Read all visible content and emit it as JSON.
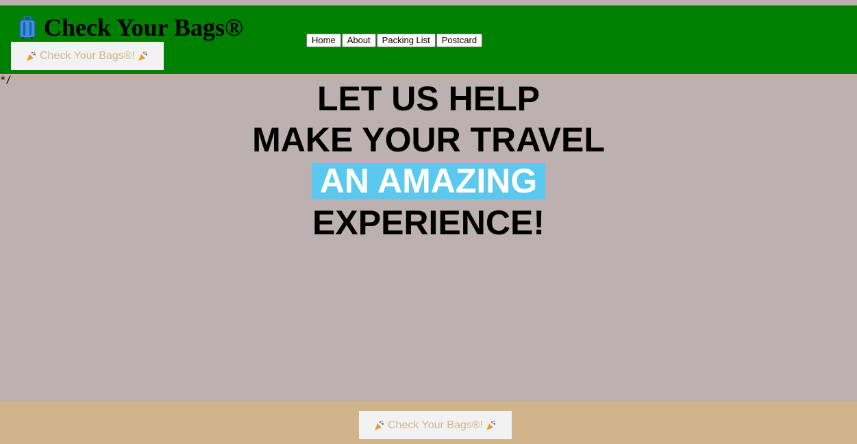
{
  "header": {
    "title": "Check Your Bags®",
    "title_icon": "luggage-icon",
    "celebrate_button": {
      "label": "Check Your Bags®!",
      "icon": "party-popper-icon"
    }
  },
  "nav": {
    "items": [
      {
        "label": "Home"
      },
      {
        "label": "About"
      },
      {
        "label": "Packing List"
      },
      {
        "label": "Postcard"
      }
    ]
  },
  "stray_text": "*/",
  "hero": {
    "line1": "LET US HELP",
    "line2": "MAKE YOUR TRAVEL",
    "highlight": "AN AMAZING",
    "line4": "EXPERIENCE!"
  },
  "footer": {
    "celebrate_button": {
      "label": "Check Your Bags®!",
      "icon": "party-popper-icon"
    }
  },
  "colors": {
    "header_bg": "#008000",
    "page_bg": "#bcb0b0",
    "footer_bg": "#d2b48c",
    "highlight_bg": "#5bc8f0",
    "button_text": "#d2b48c"
  }
}
